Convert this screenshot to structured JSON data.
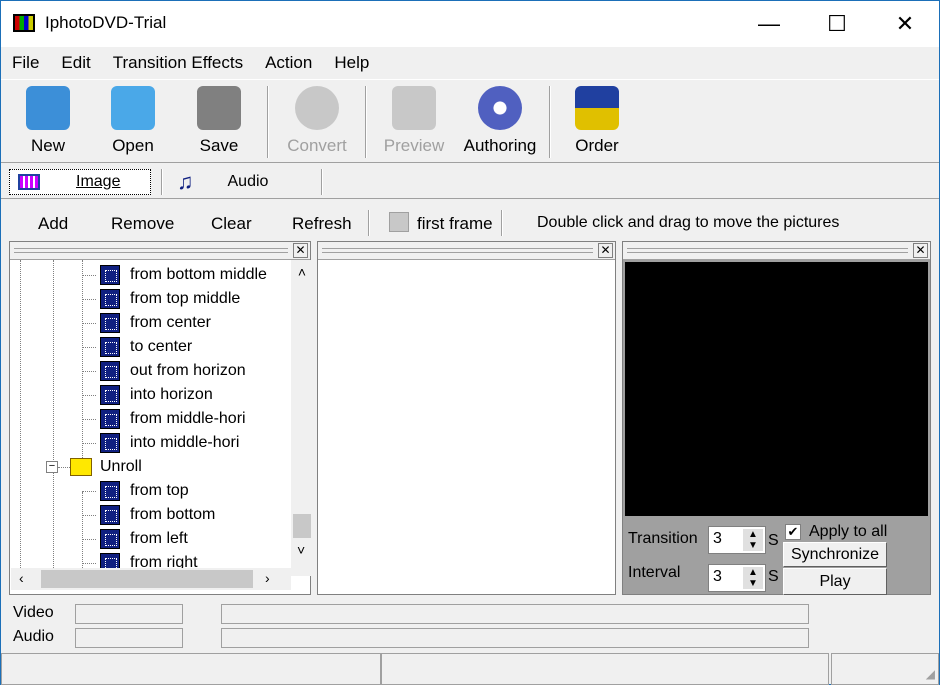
{
  "window": {
    "title": "IphotoDVD-Trial",
    "minimize": "—",
    "maximize": "☐",
    "close": "✕"
  },
  "menu": [
    "File",
    "Edit",
    "Transition Effects",
    "Action",
    "Help"
  ],
  "toolbar": [
    {
      "label": "New",
      "icon": "new-cube-icon",
      "enabled": true,
      "color": "#3c8fd8"
    },
    {
      "label": "Open",
      "icon": "open-folder-icon",
      "enabled": true,
      "color": "#4aa8e8"
    },
    {
      "label": "Save",
      "icon": "floppy-disk-icon",
      "enabled": true,
      "color": "#808080"
    },
    {
      "label": "Convert",
      "icon": "convert-disc-icon",
      "enabled": false,
      "color": "#c8c8c8"
    },
    {
      "label": "Preview",
      "icon": "preview-icon",
      "enabled": false,
      "color": "#c8c8c8"
    },
    {
      "label": "Authoring",
      "icon": "dvd-authoring-icon",
      "enabled": true,
      "color": "#5060c0"
    },
    {
      "label": "Order",
      "icon": "order-cards-icon",
      "enabled": true,
      "color": "#2040a0"
    }
  ],
  "tabs": [
    {
      "label": "Image",
      "selected": true
    },
    {
      "label": "Audio",
      "selected": false
    }
  ],
  "actions": {
    "add": "Add",
    "remove": "Remove",
    "clear": "Clear",
    "refresh": "Refresh",
    "first_frame": "first frame",
    "first_frame_checked": false,
    "hint": "Double click and drag to move the pictures"
  },
  "tree": {
    "items_before": [
      "from bottom middle",
      "from top middle",
      "from center",
      "to center",
      "out from horizon",
      "into horizon",
      "from middle-hori",
      "into middle-hori"
    ],
    "folder": {
      "label": "Unroll",
      "expanded": true
    },
    "items_after": [
      "from top",
      "from bottom",
      "from left",
      "from right"
    ]
  },
  "controls": {
    "transition_label": "Transition",
    "transition_value": "3",
    "interval_label": "Interval",
    "interval_value": "3",
    "unit": "S",
    "apply_to_all": "Apply to all",
    "apply_checked": true,
    "synchronize": "Synchronize",
    "play": "Play"
  },
  "bottom": {
    "video": "Video",
    "audio": "Audio"
  }
}
